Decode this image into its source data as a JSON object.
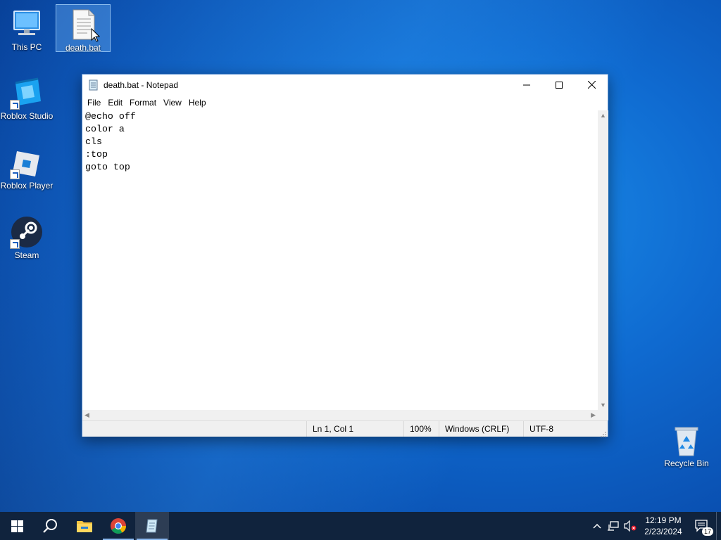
{
  "desktop": {
    "icons": [
      {
        "label": "This PC"
      },
      {
        "label": "death.bat"
      },
      {
        "label": "Roblox Studio"
      },
      {
        "label": "Roblox Player"
      },
      {
        "label": "Steam"
      },
      {
        "label": "Recycle Bin"
      }
    ]
  },
  "notepad": {
    "title": "death.bat - Notepad",
    "menu": [
      "File",
      "Edit",
      "Format",
      "View",
      "Help"
    ],
    "lines": [
      "@echo off",
      "color a",
      "cls",
      ":top",
      "goto top"
    ],
    "status": {
      "position": "Ln 1, Col 1",
      "zoom": "100%",
      "line_ending": "Windows (CRLF)",
      "encoding": "UTF-8"
    }
  },
  "taskbar": {
    "time": "12:19 PM",
    "date": "2/23/2024",
    "notification_count": "17"
  },
  "colors": {
    "taskbar": "#10233d",
    "desktop_accent": "#0f6ad0",
    "window_border": "#5a8fd0"
  }
}
